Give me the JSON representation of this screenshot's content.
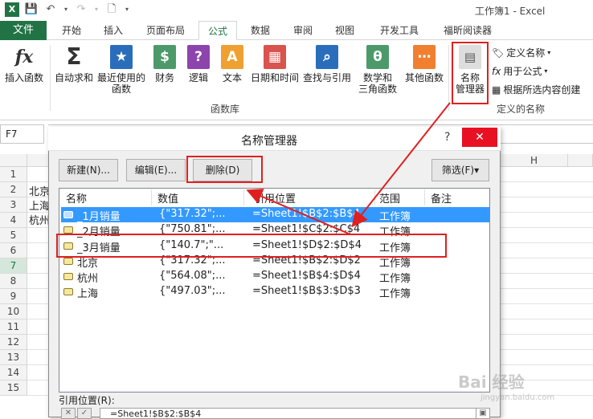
{
  "window_title": "工作簿1 - Excel",
  "quick_access": {
    "save_icon": "save-icon",
    "undo_icon": "undo-icon",
    "redo_icon": "redo-icon",
    "new_icon": "new-doc-icon"
  },
  "tabs": [
    "文件",
    "开始",
    "插入",
    "页面布局",
    "公式",
    "数据",
    "审阅",
    "视图",
    "开发工具",
    "福昕阅读器"
  ],
  "active_tab": "公式",
  "ribbon": {
    "insert_function": "插入函数",
    "autosum": "自动求和",
    "recent_line1": "最近使用的",
    "recent_line2": "函数",
    "financial": "财务",
    "logical": "逻辑",
    "text": "文本",
    "datetime": "日期和时间",
    "lookup": "查找与引用",
    "math_line1": "数学和",
    "math_line2": "三角函数",
    "more": "其他函数",
    "group_library": "函数库",
    "name_manager_line1": "名称",
    "name_manager_line2": "管理器",
    "define_name": "定义名称",
    "use_in_formula": "用于公式",
    "create_from_selection": "根据所选内容创建",
    "group_defined_names": "定义的名称"
  },
  "formula_bar": {
    "name_box": "F7",
    "content": ""
  },
  "sheet": {
    "rows": [
      "1",
      "2",
      "3",
      "4",
      "5",
      "6",
      "7",
      "8",
      "9",
      "10",
      "11",
      "12",
      "13",
      "14",
      "15"
    ],
    "selected_row": "7",
    "col_h": "H",
    "cells": {
      "a2": "北京",
      "a3": "上海",
      "a4": "杭州"
    }
  },
  "dialog": {
    "title": "名称管理器",
    "help": "?",
    "close": "✕",
    "new_btn": "新建(N)...",
    "edit_btn": "编辑(E)...",
    "delete_btn": "删除(D)",
    "filter_btn": "筛选(F)▾",
    "col_name": "名称",
    "col_value": "数值",
    "col_ref": "引用位置",
    "col_scope": "范围",
    "col_note": "备注",
    "rows": [
      {
        "name": "_1月销量",
        "value": "{\"317.32\";...",
        "ref": "=Sheet1!$B$2:$B$4",
        "scope": "工作簿"
      },
      {
        "name": "_2月销量",
        "value": "{\"750.81\";...",
        "ref": "=Sheet1!$C$2:$C$4",
        "scope": "工作簿"
      },
      {
        "name": "_3月销量",
        "value": "{\"140.7\";\"...",
        "ref": "=Sheet1!$D$2:$D$4",
        "scope": "工作簿"
      },
      {
        "name": "北京",
        "value": "{\"317.32\";...",
        "ref": "=Sheet1!$B$2:$D$2",
        "scope": "工作簿"
      },
      {
        "name": "杭州",
        "value": "{\"564.08\";...",
        "ref": "=Sheet1!$B$4:$D$4",
        "scope": "工作簿"
      },
      {
        "name": "上海",
        "value": "{\"497.03\";...",
        "ref": "=Sheet1!$B$3:$D$3",
        "scope": "工作簿"
      }
    ],
    "ref_label": "引用位置(R):",
    "ref_value": "=Sheet1!$B$2:$B$4"
  },
  "watermark": {
    "line1": "Bai 经验",
    "line2": "jingyan.baidu.com"
  },
  "colors": {
    "excel_green": "#217346",
    "highlight_red": "#e02020",
    "selection_blue": "#3399ff"
  }
}
